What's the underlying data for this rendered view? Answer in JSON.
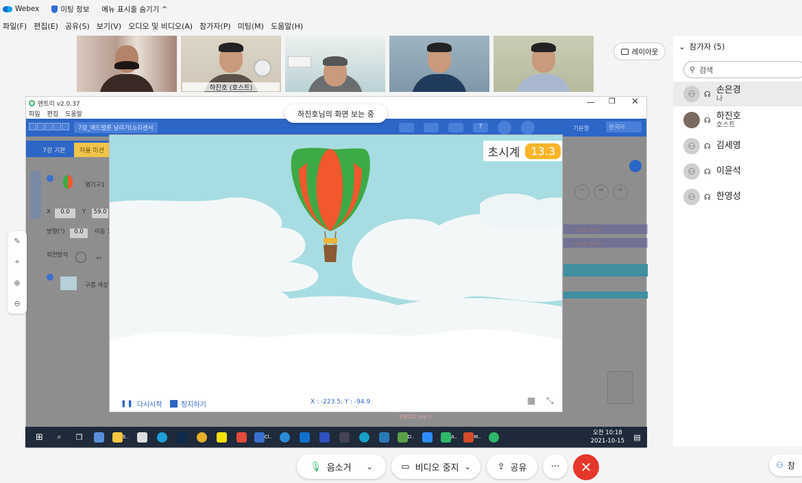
{
  "app": {
    "name": "Webex",
    "meeting_info": "미팅 정보",
    "menu_toggle": "메뉴 표시줄 숨기기 ^"
  },
  "menubar": [
    "파일(F)",
    "편집(E)",
    "공유(S)",
    "보기(V)",
    "오디오 및 비디오(A)",
    "참가자(P)",
    "미팅(M)",
    "도움말(H)"
  ],
  "video_thumbs": [
    {
      "name": ""
    },
    {
      "name": "하진호 (호스트)"
    },
    {
      "name": ""
    },
    {
      "name": ""
    },
    {
      "name": ""
    }
  ],
  "layout_button": "레이아웃",
  "viewing_badge": "하진호님의 화면 보는 중",
  "entry": {
    "title": "엔트리 v2.0.37",
    "menu": [
      "파일",
      "편집",
      "도움말"
    ],
    "project_name": "7강_에드벌룬 날리기(소리센서",
    "tabs": [
      "7강 기본",
      "자율 미션"
    ],
    "object_name": "열기구1",
    "x_label": "X",
    "x_value": "0.0",
    "y_label": "Y",
    "y_value": "59.0",
    "direction_label": "방향(°)",
    "direction_value": "0.0",
    "move_label": "이동 1",
    "rotation_label": "회전방식",
    "object2_name": "구름 세상",
    "toolbar_lang": "한국어",
    "toolbar_mode": "기본형",
    "block_text1": "(으)로 바꾸기",
    "block_text2": "(으)로 바꾸기",
    "block_change_shape": "모양으로 바꾸기"
  },
  "stage": {
    "timer_label": "초시계",
    "timer_value": "13.3",
    "restart_label": "다시시작",
    "stop_label": "정지하기",
    "coords": "X : -223.5, Y : -94.9"
  },
  "taskbar": {
    "items": [
      "E..",
      "Cl..",
      "D..",
      "A..",
      "M.."
    ],
    "time": "오전 10:18",
    "date": "2021-10-15"
  },
  "participants": {
    "header": "참가자 (5)",
    "search_placeholder": "검색",
    "list": [
      {
        "name": "손은경",
        "sub": "나"
      },
      {
        "name": "하진호",
        "sub": "호스트"
      },
      {
        "name": "김세영",
        "sub": ""
      },
      {
        "name": "이윤석",
        "sub": ""
      },
      {
        "name": "한영성",
        "sub": ""
      }
    ]
  },
  "controls": {
    "mute": "음소거",
    "stop_video": "비디오 중지",
    "share": "공유",
    "more": "···",
    "end": "✕",
    "participants_short": "참"
  },
  "colors": {
    "accent": "#2db2ff",
    "entry_blue": "#2c66c6",
    "sky": "#a7dde2",
    "timer": "#f7b42a",
    "end_call": "#e5372a",
    "balloon_green": "#3daa45",
    "balloon_orange": "#f1582d"
  }
}
